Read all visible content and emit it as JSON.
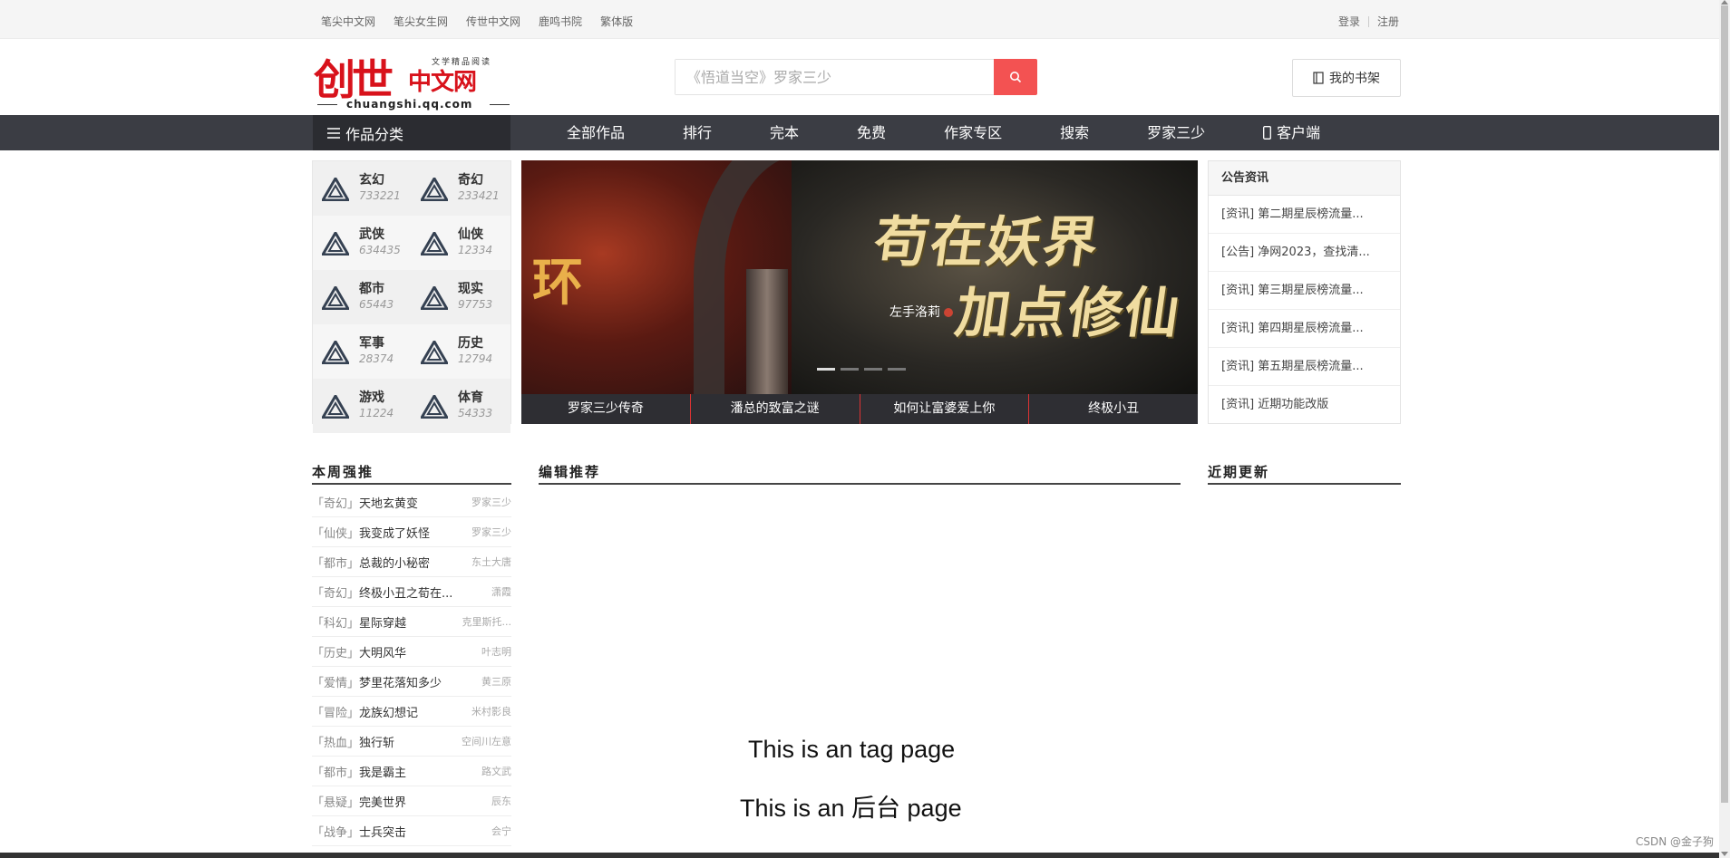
{
  "topbar": {
    "links": [
      "笔尖中文网",
      "笔尖女生网",
      "传世中文网",
      "鹿鸣书院",
      "繁体版"
    ],
    "login": "登录",
    "register": "注册"
  },
  "logo": {
    "main": "创世",
    "main2": "中文网",
    "tagline": "文学精品阅读",
    "url": "chuangshi.qq.com"
  },
  "search": {
    "placeholder": "《悟道当空》罗家三少"
  },
  "shelf_label": "我的书架",
  "nav": {
    "category_label": "作品分类",
    "items": [
      "全部作品",
      "排行",
      "完本",
      "免费",
      "作家专区",
      "搜索",
      "罗家三少",
      "客户端"
    ]
  },
  "categories": [
    {
      "name": "玄幻",
      "count": "733221"
    },
    {
      "name": "奇幻",
      "count": "233421"
    },
    {
      "name": "武侠",
      "count": "634435"
    },
    {
      "name": "仙侠",
      "count": "12334"
    },
    {
      "name": "都市",
      "count": "65443"
    },
    {
      "name": "现实",
      "count": "97753"
    },
    {
      "name": "军事",
      "count": "28374"
    },
    {
      "name": "历史",
      "count": "12794"
    },
    {
      "name": "游戏",
      "count": "11224"
    },
    {
      "name": "体育",
      "count": "54333"
    }
  ],
  "banner": {
    "title_line1": "苟在妖界",
    "title_line2": "加点修仙",
    "author": "左手洛莉",
    "left_glyph": "环",
    "tabs": [
      "罗家三少传奇",
      "潘总的致富之谜",
      "如何让富婆爱上你",
      "终极小丑"
    ],
    "active_dot": 0,
    "dot_count": 4
  },
  "notice": {
    "title": "公告资讯",
    "items": [
      "[资讯] 第二期星辰榜流量...",
      "[公告] 净网2023，查找清...",
      "[资讯] 第三期星辰榜流量...",
      "[资讯] 第四期星辰榜流量...",
      "[资讯] 第五期星辰榜流量...",
      "[资讯] 近期功能改版"
    ]
  },
  "sections": {
    "weekly": "本周强推",
    "editor": "编辑推荐",
    "recent": "近期更新"
  },
  "weekly_list": [
    {
      "genre": "「奇幻」",
      "title": "天地玄黄变",
      "author": "罗家三少"
    },
    {
      "genre": "「仙侠」",
      "title": "我变成了妖怪",
      "author": "罗家三少"
    },
    {
      "genre": "「都市」",
      "title": "总裁的小秘密",
      "author": "东土大唐"
    },
    {
      "genre": "「奇幻」",
      "title": "终极小丑之荀在...",
      "author": "潇霞"
    },
    {
      "genre": "「科幻」",
      "title": "星际穿越",
      "author": "克里斯托..."
    },
    {
      "genre": "「历史」",
      "title": "大明风华",
      "author": "叶志明"
    },
    {
      "genre": "「爱情」",
      "title": "梦里花落知多少",
      "author": "黄三原"
    },
    {
      "genre": "「冒险」",
      "title": "龙族幻想记",
      "author": "米村影良"
    },
    {
      "genre": "「热血」",
      "title": "独行斩",
      "author": "空间川左意"
    },
    {
      "genre": "「都市」",
      "title": "我是霸主",
      "author": "路文武"
    },
    {
      "genre": "「悬疑」",
      "title": "完美世界",
      "author": "辰东"
    },
    {
      "genre": "「战争」",
      "title": "士兵突击",
      "author": "会宁"
    }
  ],
  "main_text": {
    "line1": "This is an tag page",
    "line2": "This is an 后台 page"
  },
  "watermark": "CSDN @金子狗",
  "colors": {
    "brand_red": "#d8121b",
    "search_button": "#f35252",
    "nav_bg": "#3b3d44",
    "nav_category_bg": "#2b2c31"
  },
  "icons": {
    "search": "search-icon",
    "shelf": "book-icon",
    "category": "menu-icon",
    "client": "phone-icon",
    "category_item": "triangle-icon"
  }
}
